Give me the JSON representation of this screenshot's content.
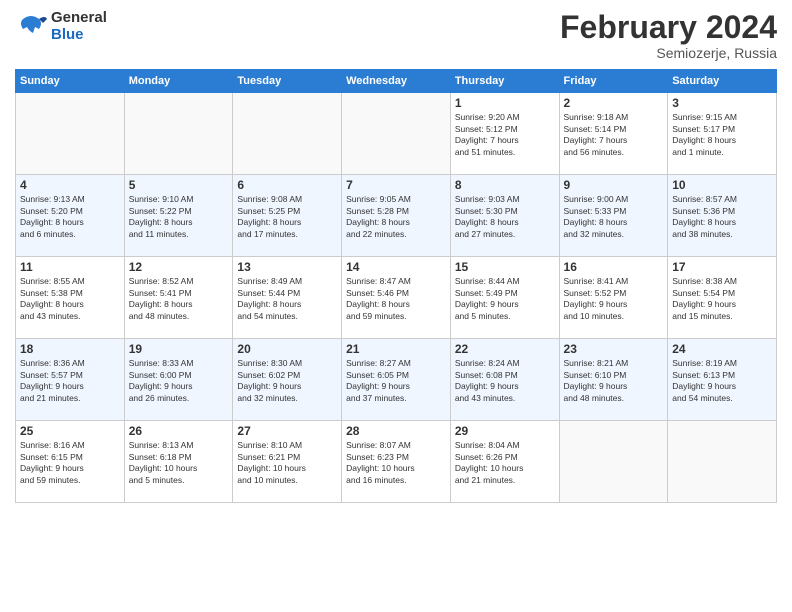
{
  "header": {
    "logo_general": "General",
    "logo_blue": "Blue",
    "month_year": "February 2024",
    "location": "Semiozerje, Russia"
  },
  "days_of_week": [
    "Sunday",
    "Monday",
    "Tuesday",
    "Wednesday",
    "Thursday",
    "Friday",
    "Saturday"
  ],
  "weeks": [
    [
      {
        "day": "",
        "info": ""
      },
      {
        "day": "",
        "info": ""
      },
      {
        "day": "",
        "info": ""
      },
      {
        "day": "",
        "info": ""
      },
      {
        "day": "1",
        "info": "Sunrise: 9:20 AM\nSunset: 5:12 PM\nDaylight: 7 hours\nand 51 minutes."
      },
      {
        "day": "2",
        "info": "Sunrise: 9:18 AM\nSunset: 5:14 PM\nDaylight: 7 hours\nand 56 minutes."
      },
      {
        "day": "3",
        "info": "Sunrise: 9:15 AM\nSunset: 5:17 PM\nDaylight: 8 hours\nand 1 minute."
      }
    ],
    [
      {
        "day": "4",
        "info": "Sunrise: 9:13 AM\nSunset: 5:20 PM\nDaylight: 8 hours\nand 6 minutes."
      },
      {
        "day": "5",
        "info": "Sunrise: 9:10 AM\nSunset: 5:22 PM\nDaylight: 8 hours\nand 11 minutes."
      },
      {
        "day": "6",
        "info": "Sunrise: 9:08 AM\nSunset: 5:25 PM\nDaylight: 8 hours\nand 17 minutes."
      },
      {
        "day": "7",
        "info": "Sunrise: 9:05 AM\nSunset: 5:28 PM\nDaylight: 8 hours\nand 22 minutes."
      },
      {
        "day": "8",
        "info": "Sunrise: 9:03 AM\nSunset: 5:30 PM\nDaylight: 8 hours\nand 27 minutes."
      },
      {
        "day": "9",
        "info": "Sunrise: 9:00 AM\nSunset: 5:33 PM\nDaylight: 8 hours\nand 32 minutes."
      },
      {
        "day": "10",
        "info": "Sunrise: 8:57 AM\nSunset: 5:36 PM\nDaylight: 8 hours\nand 38 minutes."
      }
    ],
    [
      {
        "day": "11",
        "info": "Sunrise: 8:55 AM\nSunset: 5:38 PM\nDaylight: 8 hours\nand 43 minutes."
      },
      {
        "day": "12",
        "info": "Sunrise: 8:52 AM\nSunset: 5:41 PM\nDaylight: 8 hours\nand 48 minutes."
      },
      {
        "day": "13",
        "info": "Sunrise: 8:49 AM\nSunset: 5:44 PM\nDaylight: 8 hours\nand 54 minutes."
      },
      {
        "day": "14",
        "info": "Sunrise: 8:47 AM\nSunset: 5:46 PM\nDaylight: 8 hours\nand 59 minutes."
      },
      {
        "day": "15",
        "info": "Sunrise: 8:44 AM\nSunset: 5:49 PM\nDaylight: 9 hours\nand 5 minutes."
      },
      {
        "day": "16",
        "info": "Sunrise: 8:41 AM\nSunset: 5:52 PM\nDaylight: 9 hours\nand 10 minutes."
      },
      {
        "day": "17",
        "info": "Sunrise: 8:38 AM\nSunset: 5:54 PM\nDaylight: 9 hours\nand 15 minutes."
      }
    ],
    [
      {
        "day": "18",
        "info": "Sunrise: 8:36 AM\nSunset: 5:57 PM\nDaylight: 9 hours\nand 21 minutes."
      },
      {
        "day": "19",
        "info": "Sunrise: 8:33 AM\nSunset: 6:00 PM\nDaylight: 9 hours\nand 26 minutes."
      },
      {
        "day": "20",
        "info": "Sunrise: 8:30 AM\nSunset: 6:02 PM\nDaylight: 9 hours\nand 32 minutes."
      },
      {
        "day": "21",
        "info": "Sunrise: 8:27 AM\nSunset: 6:05 PM\nDaylight: 9 hours\nand 37 minutes."
      },
      {
        "day": "22",
        "info": "Sunrise: 8:24 AM\nSunset: 6:08 PM\nDaylight: 9 hours\nand 43 minutes."
      },
      {
        "day": "23",
        "info": "Sunrise: 8:21 AM\nSunset: 6:10 PM\nDaylight: 9 hours\nand 48 minutes."
      },
      {
        "day": "24",
        "info": "Sunrise: 8:19 AM\nSunset: 6:13 PM\nDaylight: 9 hours\nand 54 minutes."
      }
    ],
    [
      {
        "day": "25",
        "info": "Sunrise: 8:16 AM\nSunset: 6:15 PM\nDaylight: 9 hours\nand 59 minutes."
      },
      {
        "day": "26",
        "info": "Sunrise: 8:13 AM\nSunset: 6:18 PM\nDaylight: 10 hours\nand 5 minutes."
      },
      {
        "day": "27",
        "info": "Sunrise: 8:10 AM\nSunset: 6:21 PM\nDaylight: 10 hours\nand 10 minutes."
      },
      {
        "day": "28",
        "info": "Sunrise: 8:07 AM\nSunset: 6:23 PM\nDaylight: 10 hours\nand 16 minutes."
      },
      {
        "day": "29",
        "info": "Sunrise: 8:04 AM\nSunset: 6:26 PM\nDaylight: 10 hours\nand 21 minutes."
      },
      {
        "day": "",
        "info": ""
      },
      {
        "day": "",
        "info": ""
      }
    ]
  ]
}
